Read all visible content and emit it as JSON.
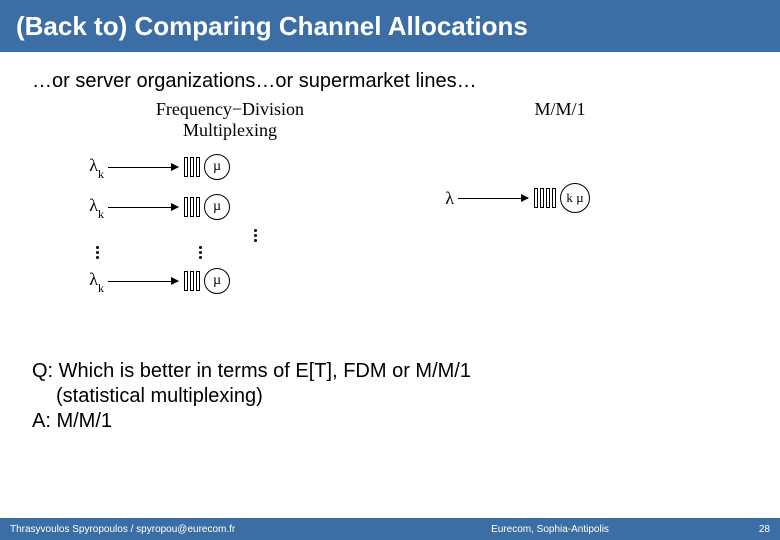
{
  "title": "(Back to) Comparing Channel Allocations",
  "subtitle": "…or server organizations…or supermarket lines…",
  "diagram": {
    "fdm_title": "Frequency−Division\nMultiplexing",
    "mm1_title": "M/M/1",
    "lambda": "λ",
    "frac_k": "k",
    "mu": "µ",
    "kmu": "k µ"
  },
  "qa": {
    "q_line1": "Q: Which is better in terms of E[T], FDM or M/M/1",
    "q_line2": "(statistical multiplexing)",
    "a_line": "A: M/M/1"
  },
  "footer": {
    "left": "Thrasyvoulos Spyropoulos / spyropou@eurecom.fr",
    "center": "Eurecom, Sophia-Antipolis",
    "right": "28"
  }
}
